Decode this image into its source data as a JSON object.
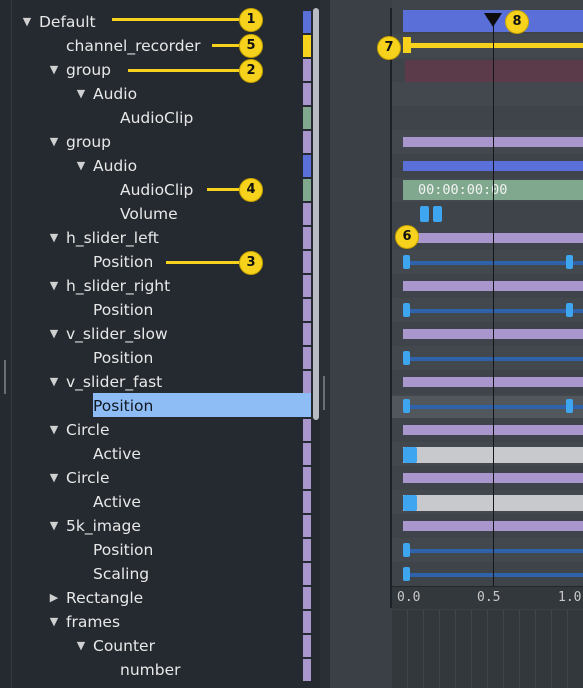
{
  "tree": {
    "rows": [
      {
        "label": "Default",
        "expanded": true
      },
      {
        "label": "channel_recorder",
        "expanded": null
      },
      {
        "label": "group",
        "expanded": true
      },
      {
        "label": "Audio",
        "expanded": true
      },
      {
        "label": "AudioClip",
        "expanded": null
      },
      {
        "label": "group",
        "expanded": true
      },
      {
        "label": "Audio",
        "expanded": true
      },
      {
        "label": "AudioClip",
        "expanded": null
      },
      {
        "label": "Volume",
        "expanded": null
      },
      {
        "label": "h_slider_left",
        "expanded": true
      },
      {
        "label": "Position",
        "expanded": null
      },
      {
        "label": "h_slider_right",
        "expanded": true
      },
      {
        "label": "Position",
        "expanded": null
      },
      {
        "label": "v_slider_slow",
        "expanded": true
      },
      {
        "label": "Position",
        "expanded": null
      },
      {
        "label": "v_slider_fast",
        "expanded": true
      },
      {
        "label": "Position",
        "expanded": null,
        "selected": true
      },
      {
        "label": "Circle",
        "expanded": true
      },
      {
        "label": "Active",
        "expanded": null
      },
      {
        "label": "Circle",
        "expanded": true
      },
      {
        "label": "Active",
        "expanded": null
      },
      {
        "label": "5k_image",
        "expanded": true
      },
      {
        "label": "Position",
        "expanded": null
      },
      {
        "label": "Scaling",
        "expanded": null
      },
      {
        "label": "Rectangle",
        "expanded": false
      },
      {
        "label": "frames",
        "expanded": true
      },
      {
        "label": "Counter",
        "expanded": true
      },
      {
        "label": "number",
        "expanded": null
      }
    ]
  },
  "timeline": {
    "clip_timecode": "00:00:00:00",
    "ruler_labels": [
      "0.0",
      "0.5",
      "1.0"
    ]
  },
  "callouts": [
    "1",
    "2",
    "3",
    "4",
    "5",
    "6",
    "7",
    "8"
  ],
  "colors": {
    "accent_blue": "#5b6fd8",
    "lavender": "#a996cc",
    "yellow": "#f7d21c",
    "audio_green": "#7fa88e",
    "selection": "#8ebcf5",
    "keyframe": "#3ea6f0"
  }
}
